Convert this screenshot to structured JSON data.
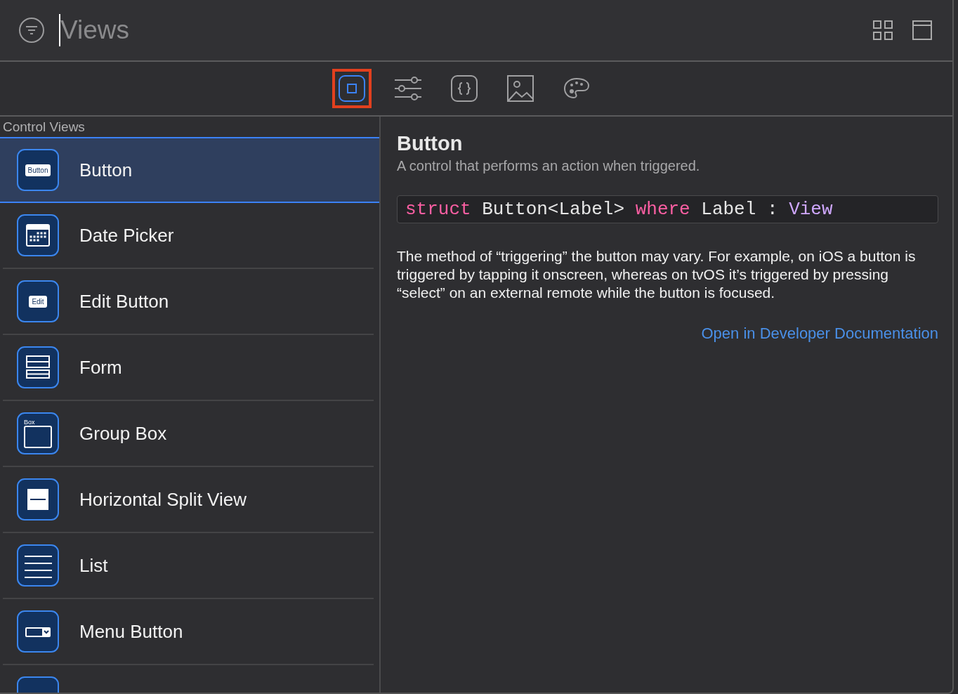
{
  "search": {
    "placeholder": "Views"
  },
  "header_buttons": [
    {
      "kind": "grid"
    },
    {
      "kind": "window"
    }
  ],
  "tabs": [
    {
      "kind": "views",
      "selected": true
    },
    {
      "kind": "modifiers",
      "selected": false
    },
    {
      "kind": "snippets",
      "selected": false
    },
    {
      "kind": "media",
      "selected": false
    },
    {
      "kind": "colors",
      "selected": false
    }
  ],
  "list": {
    "section": "Control Views",
    "items": [
      {
        "label": "Button",
        "kind": "button",
        "icon_text": "Button",
        "selected": true
      },
      {
        "label": "Date Picker",
        "kind": "calendar",
        "selected": false
      },
      {
        "label": "Edit Button",
        "kind": "button",
        "icon_text": "Edit",
        "selected": false
      },
      {
        "label": "Form",
        "kind": "form",
        "selected": false
      },
      {
        "label": "Group Box",
        "kind": "groupbox",
        "icon_text": "Box",
        "selected": false
      },
      {
        "label": "Horizontal Split View",
        "kind": "split",
        "selected": false
      },
      {
        "label": "List",
        "kind": "list",
        "selected": false
      },
      {
        "label": "Menu Button",
        "kind": "menu",
        "selected": false
      },
      {
        "kind": "blank",
        "selected": false
      }
    ]
  },
  "detail": {
    "title": "Button",
    "subtitle": "A control that performs an action when triggered.",
    "declaration": [
      {
        "kind": "keyword",
        "text": "struct"
      },
      {
        "kind": "plain",
        "text": "Button<Label>"
      },
      {
        "kind": "keyword",
        "text": "where"
      },
      {
        "kind": "plain",
        "text": "Label"
      },
      {
        "kind": "plain",
        "text": ":"
      },
      {
        "kind": "type",
        "text": "View"
      }
    ],
    "body": "The method of “triggering” the button may vary. For example, on iOS a button is triggered by tapping it onscreen, whereas on tvOS it’s triggered by pressing “select” on an external remote while the button is focused.",
    "link": "Open in Developer Documentation"
  }
}
